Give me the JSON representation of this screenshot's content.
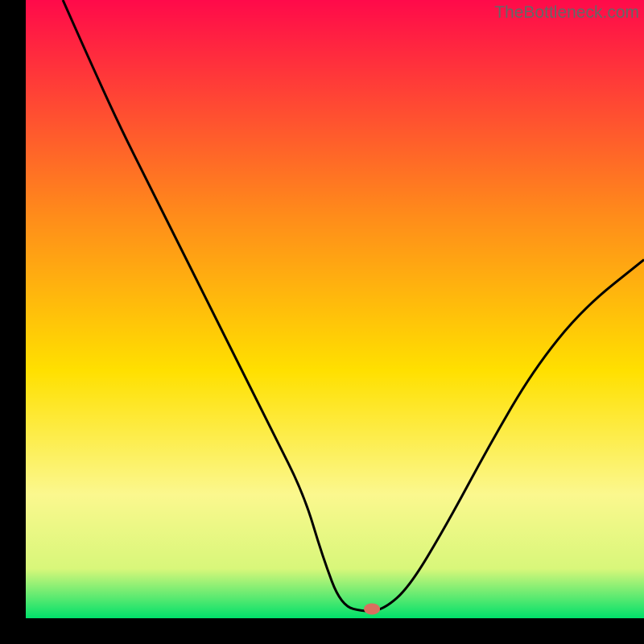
{
  "watermark": "TheBottleneck.com",
  "chart_data": {
    "type": "line",
    "title": "",
    "xlabel": "",
    "ylabel": "",
    "xlim": [
      0,
      100
    ],
    "ylim": [
      0,
      100
    ],
    "gradient_stops": [
      {
        "offset": 0,
        "color": "#ff0a4a"
      },
      {
        "offset": 35,
        "color": "#ff8c1a"
      },
      {
        "offset": 60,
        "color": "#ffe000"
      },
      {
        "offset": 80,
        "color": "#fbf88e"
      },
      {
        "offset": 92,
        "color": "#d8f77a"
      },
      {
        "offset": 100,
        "color": "#00e06a"
      }
    ],
    "series": [
      {
        "name": "curve",
        "color": "#000000",
        "x": [
          6,
          10,
          15,
          20,
          25,
          30,
          35,
          40,
          45,
          48,
          51,
          55,
          58,
          62,
          68,
          75,
          82,
          90,
          100
        ],
        "values": [
          100,
          91,
          80,
          70,
          60,
          50,
          40,
          30,
          20,
          10,
          2,
          1,
          1.5,
          5,
          15,
          28,
          40,
          50,
          58
        ]
      }
    ],
    "marker": {
      "x": 56,
      "y": 1.5,
      "color": "#d96f5f"
    }
  }
}
